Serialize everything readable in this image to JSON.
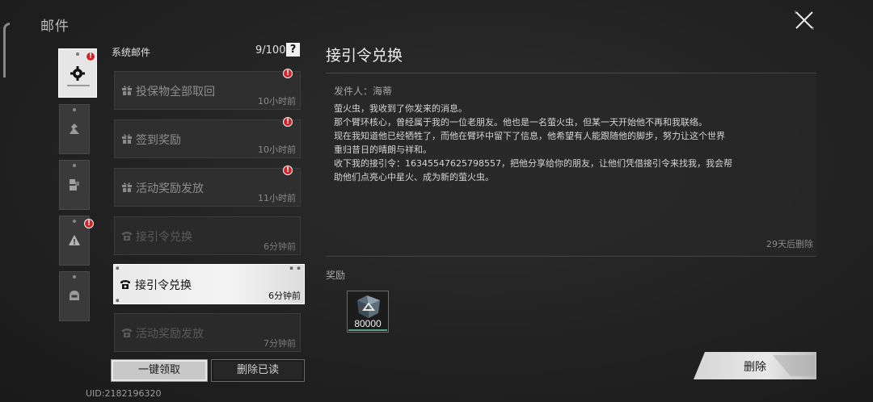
{
  "window": {
    "title": "邮件"
  },
  "categories": [
    {
      "name": "system-mail",
      "active": true,
      "has_dot": true,
      "icon": "gear-icon"
    },
    {
      "name": "category-2",
      "active": false,
      "has_dot": false,
      "icon": "figure-icon"
    },
    {
      "name": "category-3",
      "active": false,
      "has_dot": false,
      "icon": "blocks-icon"
    },
    {
      "name": "category-4",
      "active": false,
      "has_dot": true,
      "icon": "warning-icon"
    },
    {
      "name": "category-5",
      "active": false,
      "has_dot": false,
      "icon": "mask-icon"
    }
  ],
  "list": {
    "header": "系统邮件",
    "count": "9/100",
    "help": "?",
    "items": [
      {
        "title": "投保物全部取回",
        "time": "10小时前",
        "icon": "gift-icon",
        "unread": true,
        "selected": false
      },
      {
        "title": "签到奖励",
        "time": "10小时前",
        "icon": "gift-icon",
        "unread": true,
        "selected": false
      },
      {
        "title": "活动奖励发放",
        "time": "11小时前",
        "icon": "gift-icon",
        "unread": true,
        "selected": false
      },
      {
        "title": "接引令兑换",
        "time": "6分钟前",
        "icon": "phone-icon",
        "unread": false,
        "selected": false
      },
      {
        "title": "接引令兑换",
        "time": "6分钟前",
        "icon": "phone-icon",
        "unread": false,
        "selected": true
      },
      {
        "title": "活动奖励发放",
        "time": "7分钟前",
        "icon": "phone-icon",
        "unread": false,
        "selected": false
      }
    ]
  },
  "buttons": {
    "claim_all": "一键领取",
    "delete_read": "删除已读",
    "delete": "删除"
  },
  "uid": "UID:2182196320",
  "detail": {
    "title": "接引令兑换",
    "sender": "发件人：海蒂",
    "body": [
      "萤火虫，我收到了你发来的消息。",
      "那个臂环核心，曾经属于我的一位老朋友。他也是一名萤火虫，但某一天开始他不再和我联络。",
      "现在我知道他已经牺牲了，而他在臂环中留下了信息，他希望有人能跟随他的脚步，努力让这个世界",
      "重归昔日的晴朗与祥和。",
      "收下我的接引令：16345547625798557，把他分享给你的朋友，让他们凭借接引令来找我，我会帮",
      "助他们点亮心中星火、成为新的萤火虫。"
    ],
    "expire": "29天后删除",
    "reward_label": "奖励",
    "reward": {
      "amount": "80000",
      "icon": "crystal-icon"
    }
  },
  "colors": {
    "accent_red": "#d2232a",
    "reward_bar": "#5aa08a"
  }
}
